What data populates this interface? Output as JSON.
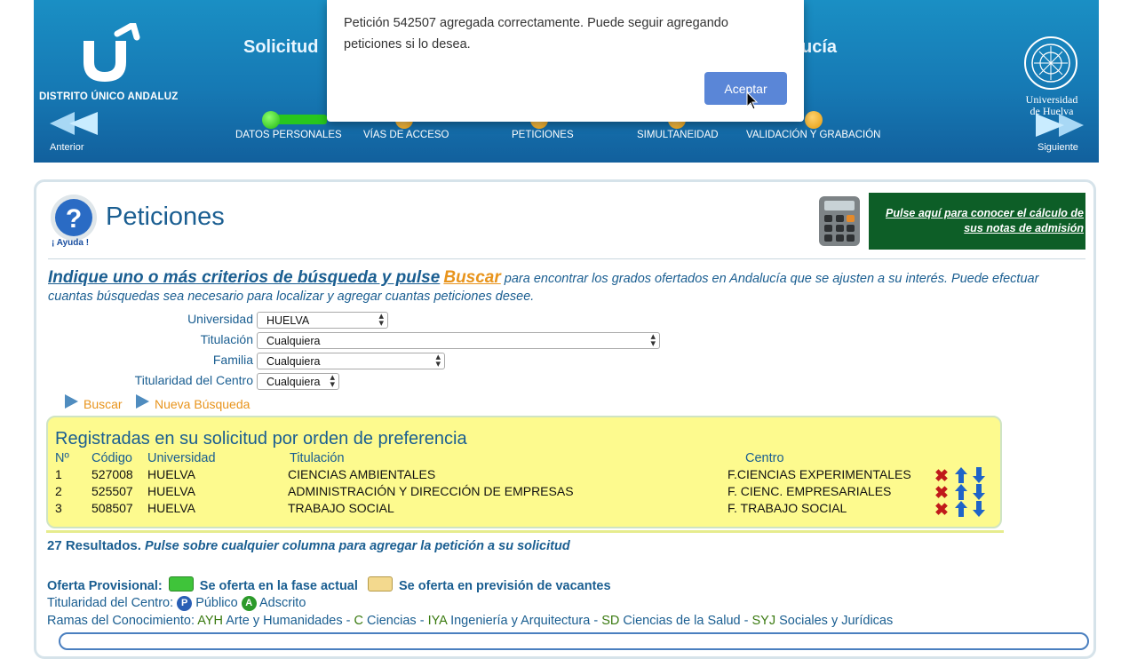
{
  "header": {
    "brand": "DISTRITO ÚNICO ANDALUZ",
    "title_left": "Solicitud",
    "title_right": "ucía",
    "prev_label": "Anterior",
    "next_label": "Siguiente",
    "university_name": "Universidad de Huelva",
    "steps": [
      "DATOS PERSONALES",
      "VÍAS DE ACCESO",
      "PETICIONES",
      "SIMULTANEIDAD",
      "VALIDACIÓN Y GRABACIÓN"
    ]
  },
  "dialog": {
    "message": "Petición 542507 agregada correctamente. Puede seguir agregando peticiones si lo desea.",
    "ok_label": "Aceptar"
  },
  "page": {
    "help_label": "¡ Ayuda !",
    "title": "Peticiones",
    "calc_banner": "Pulse aquí para conocer el cálculo de sus notas de admisión"
  },
  "intro": {
    "head": "Indique uno o más criterios de búsqueda y pulse",
    "buscar": "Buscar",
    "text": " para encontrar los grados ofertados en Andalucía que se ajusten a su interés. Puede efectuar cuantas búsquedas sea necesario para localizar y agregar cuantas peticiones desee."
  },
  "filters": {
    "universidad": {
      "label": "Universidad",
      "value": "HUELVA"
    },
    "titulacion": {
      "label": "Titulación",
      "value": "Cualquiera"
    },
    "familia": {
      "label": "Familia",
      "value": "Cualquiera"
    },
    "titularidad": {
      "label": "Titularidad del Centro",
      "value": "Cualquiera"
    }
  },
  "actions": {
    "buscar": "Buscar",
    "nueva": "Nueva Búsqueda"
  },
  "registered": {
    "title": "Registradas en su solicitud por orden de preferencia",
    "columns": {
      "n": "Nº",
      "codigo": "Código",
      "universidad": "Universidad",
      "titulacion": "Titulación",
      "centro": "Centro"
    },
    "rows": [
      {
        "n": "1",
        "codigo": "527008",
        "universidad": "HUELVA",
        "titulacion": "CIENCIAS AMBIENTALES",
        "centro": "F.CIENCIAS EXPERIMENTALES"
      },
      {
        "n": "2",
        "codigo": "525507",
        "universidad": "HUELVA",
        "titulacion": "ADMINISTRACIÓN Y DIRECCIÓN DE EMPRESAS",
        "centro": "F. CIENC. EMPRESARIALES"
      },
      {
        "n": "3",
        "codigo": "508507",
        "universidad": "HUELVA",
        "titulacion": "TRABAJO SOCIAL",
        "centro": "F. TRABAJO SOCIAL"
      }
    ]
  },
  "results": {
    "count": "27 Resultados.",
    "hint": "Pulse sobre cualquier columna para agregar la petición a su solicitud"
  },
  "legend": {
    "oferta_label": "Oferta Provisional:",
    "actual": "Se oferta en la fase actual",
    "prevision": "Se oferta en previsión de vacantes",
    "titularidad_label": "Titularidad del Centro:",
    "publico_badge": "P",
    "publico": "Público",
    "adscrito_badge": "A",
    "adscrito": "Adscrito",
    "ramas_label": "Ramas del Conocimiento:",
    "ramas": [
      {
        "code": "AYH",
        "name": "Arte y Humanidades"
      },
      {
        "code": "C",
        "name": "Ciencias"
      },
      {
        "code": "IYA",
        "name": "Ingeniería y Arquitectura"
      },
      {
        "code": "SD",
        "name": "Ciencias de la Salud"
      },
      {
        "code": "SYJ",
        "name": "Sociales y Jurídicas"
      }
    ],
    "separator": "-"
  },
  "colors": {
    "header": "#1679b4",
    "accent": "#e8941c",
    "text": "#1a5e91",
    "reg_box": "#fdfa8e",
    "ok_button": "#5a86d7",
    "banner": "#0d5e27"
  }
}
